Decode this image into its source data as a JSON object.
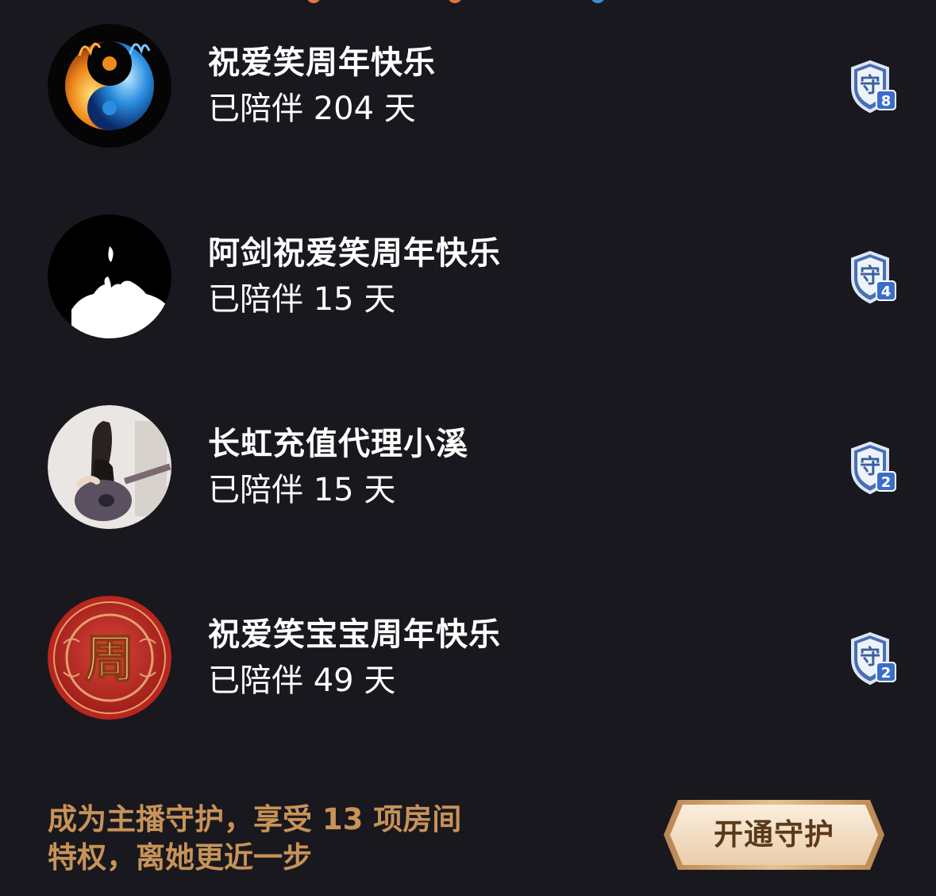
{
  "guard_list": [
    {
      "name": "祝爱笑周年快乐",
      "days": "已陪伴 204 天",
      "avatar": "yin-yang-fire-ice-avatar",
      "badge_char": "守",
      "badge_level": "8"
    },
    {
      "name": "阿剑祝爱笑周年快乐",
      "days": "已陪伴 15 天",
      "avatar": "silhouette-kiss-avatar",
      "badge_char": "守",
      "badge_level": "4"
    },
    {
      "name": "长虹充值代理小溪",
      "days": "已陪伴 15 天",
      "avatar": "girl-guitar-avatar",
      "badge_char": "守",
      "badge_level": "2"
    },
    {
      "name": "祝爱笑宝宝周年快乐",
      "days": "已陪伴 49 天",
      "avatar": "zhou-seal-avatar",
      "avatar_char": "周",
      "badge_char": "守",
      "badge_level": "2"
    }
  ],
  "footer": {
    "promo_line1": "成为主播守护，享受 13 项房间",
    "promo_line2": "特权，离她更近一步",
    "open_button_label": "开通守护"
  },
  "colors": {
    "background": "#19181e",
    "promo_text": "#c89358",
    "button_text": "#5a3a18",
    "badge_blue": "#3a6ec8"
  }
}
